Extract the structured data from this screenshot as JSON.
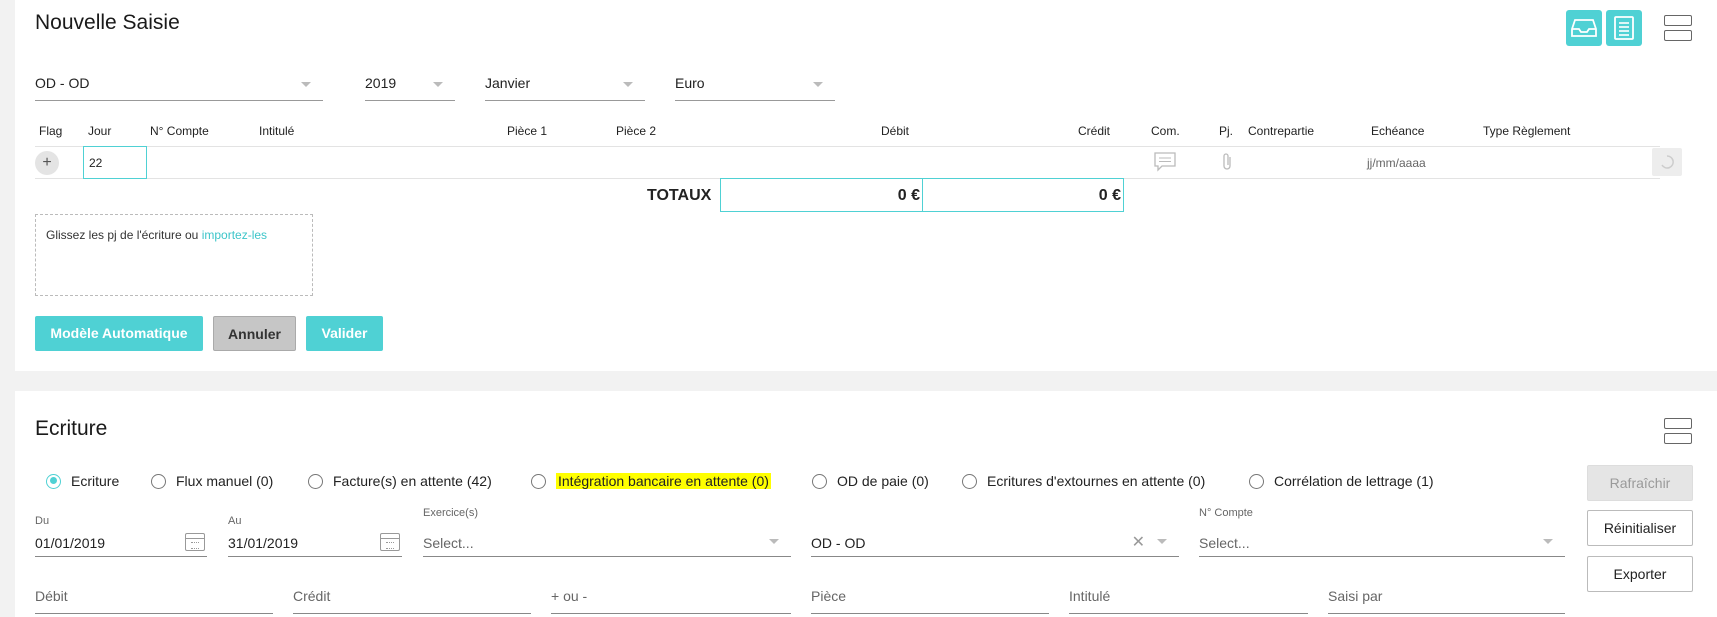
{
  "saisie": {
    "title": "Nouvelle Saisie",
    "icons": [
      "inbox-icon",
      "list-icon",
      "layout-split-icon"
    ],
    "journal_select": "OD - OD",
    "year_select": "2019",
    "month_select": "Janvier",
    "currency_select": "Euro",
    "columns": [
      "Flag",
      "Jour",
      "N° Compte",
      "Intitulé",
      "Pièce 1",
      "Pièce 2",
      "Débit",
      "Crédit",
      "Com.",
      "Pj.",
      "Contrepartie",
      "Echéance",
      "Type Règlement"
    ],
    "row": {
      "add_label": "+",
      "jour_value": "22",
      "echeance_placeholder": "jj/mm/aaaa"
    },
    "totals": {
      "label": "TOTAUX",
      "debit": "0 €",
      "credit": "0 €"
    },
    "dropzone": {
      "text": "Glissez les pj de l'écriture ou ",
      "link": "importez-les"
    },
    "buttons": {
      "auto_model": "Modèle Automatique",
      "cancel": "Annuler",
      "validate": "Valider"
    },
    "accent_color": "#4fd1d4"
  },
  "ecriture": {
    "title": "Ecriture",
    "filters": [
      {
        "label": "Ecriture",
        "checked": true
      },
      {
        "label": "Flux manuel (0)",
        "checked": false
      },
      {
        "label": "Facture(s) en attente (42)",
        "checked": false
      },
      {
        "label": "Intégration bancaire en attente (0)",
        "checked": false,
        "highlight": "#ffff00"
      },
      {
        "label": "OD de paie (0)",
        "checked": false
      },
      {
        "label": "Ecritures d'extournes en attente (0)",
        "checked": false
      },
      {
        "label": "Corrélation de lettrage (1)",
        "checked": false
      }
    ],
    "buttons": {
      "refresh": "Rafraîchir",
      "reset": "Réinitialiser",
      "export": "Exporter"
    },
    "du_label": "Du",
    "du_value": "01/01/2019",
    "au_label": "Au",
    "au_value": "31/01/2019",
    "exercice_label": "Exercice(s)",
    "exercice_placeholder": "Select...",
    "journal_value": "OD - OD",
    "compte_label": "N° Compte",
    "compte_placeholder": "Select...",
    "bottom_fields": [
      "Débit",
      "Crédit",
      "+ ou -",
      "Pièce",
      "Intitulé",
      "Saisi par"
    ]
  }
}
